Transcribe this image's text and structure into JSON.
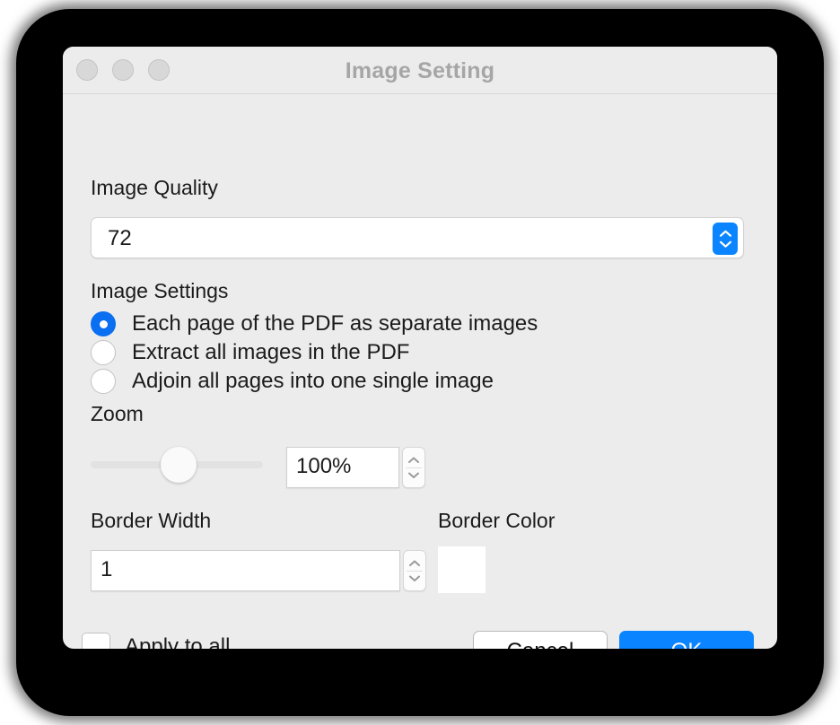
{
  "window": {
    "title": "Image Setting",
    "traffic_lights": [
      "close-button",
      "minimize-button",
      "zoom-button"
    ]
  },
  "accent_color": "#0a84ff",
  "radio_selected_color": "#0a6ff0",
  "image_quality": {
    "label": "Image Quality",
    "value": "72"
  },
  "image_settings": {
    "label": "Image Settings",
    "options": [
      {
        "label": "Each page of the PDF as separate images",
        "selected": true
      },
      {
        "label": "Extract all images in the PDF",
        "selected": false
      },
      {
        "label": "Adjoin all pages into one single image",
        "selected": false
      }
    ]
  },
  "zoom": {
    "label": "Zoom",
    "value": "100%",
    "slider_percent": 50
  },
  "border_width": {
    "label": "Border Width",
    "value": "1"
  },
  "border_color": {
    "label": "Border Color",
    "swatch": "#ffffff"
  },
  "footer": {
    "apply_to_all_label": "Apply to all",
    "apply_to_all_checked": false,
    "cancel_label": "Cancel",
    "ok_label": "OK"
  }
}
